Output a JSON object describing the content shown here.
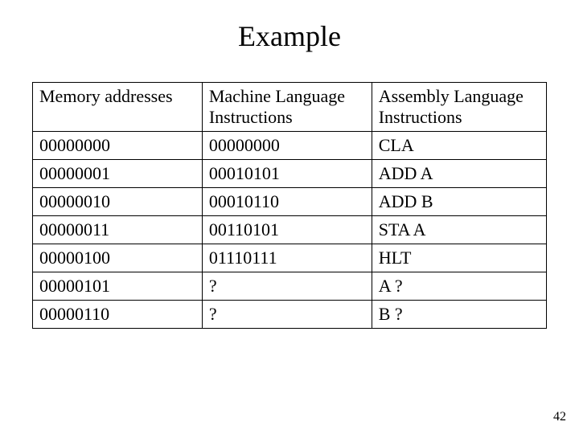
{
  "title": "Example",
  "headers": {
    "col_a": "Memory addresses",
    "col_b": "Machine Language Instructions",
    "col_c": "Assembly Language Instructions"
  },
  "rows": [
    {
      "addr": "00000000",
      "machine": "00000000",
      "asm": "CLA"
    },
    {
      "addr": "00000001",
      "machine": "00010101",
      "asm": "ADD A"
    },
    {
      "addr": "00000010",
      "machine": "00010110",
      "asm": "ADD B"
    },
    {
      "addr": "00000011",
      "machine": "00110101",
      "asm": "STA A"
    },
    {
      "addr": "00000100",
      "machine": "01110111",
      "asm": "HLT"
    },
    {
      "addr": "00000101",
      "machine": "?",
      "asm": "A ?"
    },
    {
      "addr": "00000110",
      "machine": "?",
      "asm": "B ?"
    }
  ],
  "page_number": "42"
}
